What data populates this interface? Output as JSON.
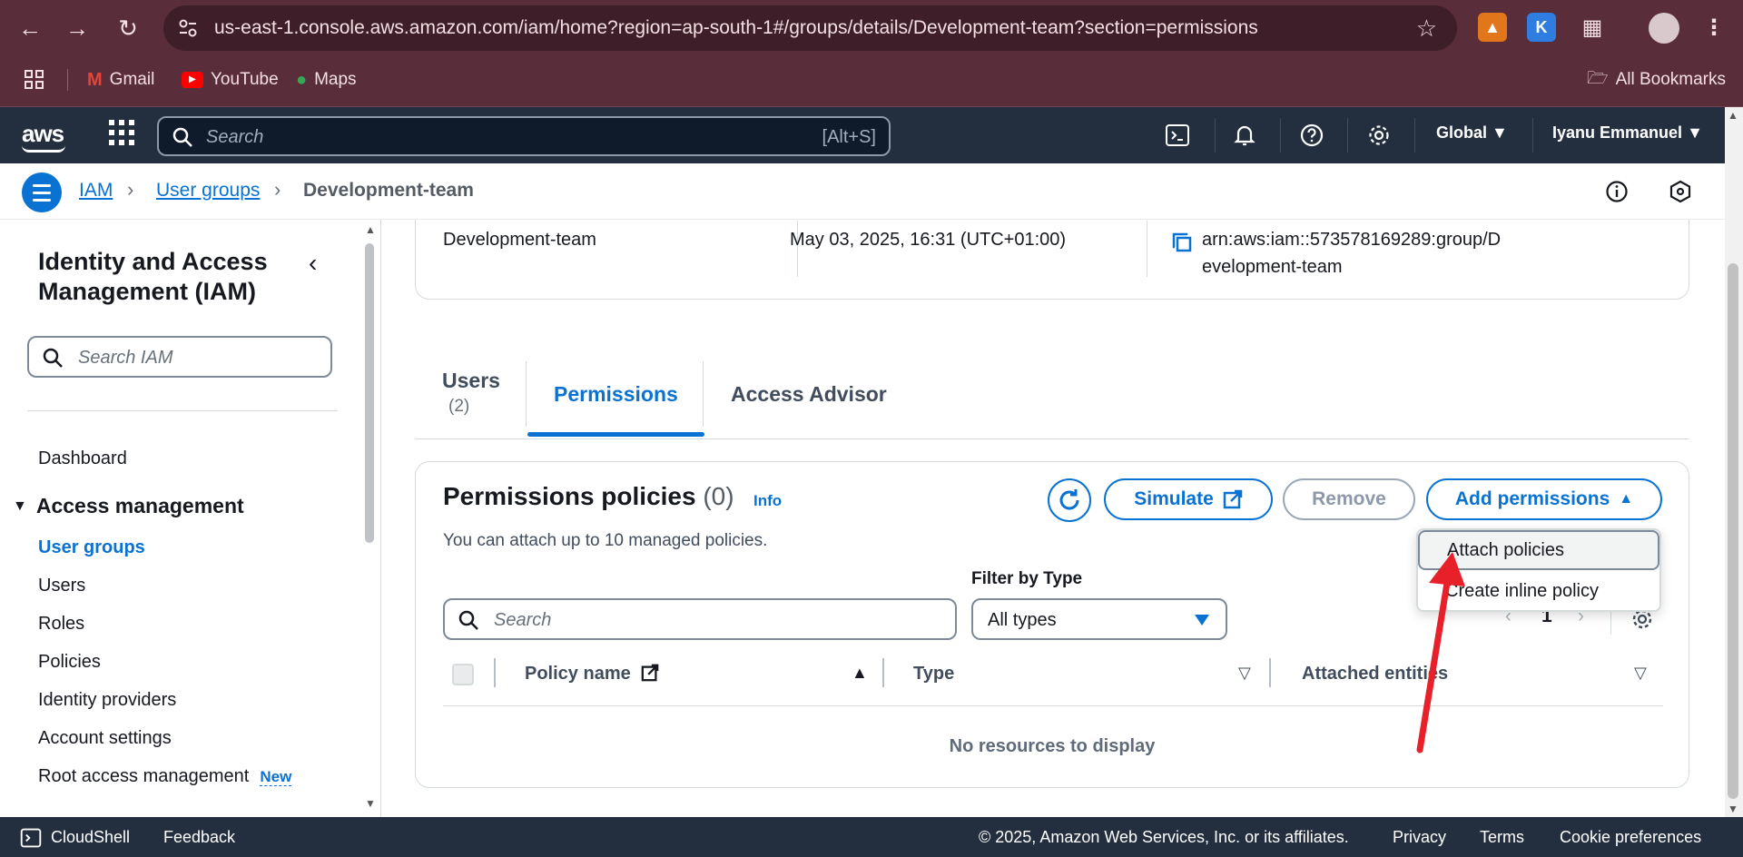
{
  "browser": {
    "url": "us-east-1.console.aws.amazon.com/iam/home?region=ap-south-1#/groups/details/Development-team?section=permissions",
    "bookmarks": [
      "Gmail",
      "YouTube",
      "Maps"
    ],
    "all_bookmarks": "All Bookmarks",
    "ext_k": "K"
  },
  "aws_nav": {
    "logo": "aws",
    "search_placeholder": "Search",
    "search_shortcut": "[Alt+S]",
    "region": "Global",
    "user": "Iyanu Emmanuel"
  },
  "breadcrumb": {
    "items": [
      "IAM",
      "User groups",
      "Development-team"
    ]
  },
  "sidebar": {
    "title": "Identity and Access Management (IAM)",
    "search_placeholder": "Search IAM",
    "dashboard": "Dashboard",
    "section": "Access management",
    "items": [
      "User groups",
      "Users",
      "Roles",
      "Policies",
      "Identity providers",
      "Account settings",
      "Root access management"
    ],
    "new_badge": "New"
  },
  "summary": {
    "group_name": "Development-team",
    "created": "May 03, 2025, 16:31 (UTC+01:00)",
    "arn_line1": "arn:aws:iam::573578169289:group/D",
    "arn_line2": "evelopment-team"
  },
  "tabs": {
    "users": "Users",
    "users_count": "(2)",
    "permissions": "Permissions",
    "access_advisor": "Access Advisor"
  },
  "permissions": {
    "title": "Permissions policies",
    "count": "(0)",
    "info": "Info",
    "description": "You can attach up to 10 managed policies.",
    "simulate": "Simulate",
    "remove": "Remove",
    "add_permissions": "Add permissions",
    "filter_label": "Filter by Type",
    "search_placeholder": "Search",
    "filter_value": "All types",
    "page": "1",
    "columns": [
      "Policy name",
      "Type",
      "Attached entities"
    ],
    "empty": "No resources to display"
  },
  "dropdown": {
    "items": [
      "Attach policies",
      "Create inline policy"
    ]
  },
  "footer": {
    "cloudshell": "CloudShell",
    "feedback": "Feedback",
    "copyright": "© 2025, Amazon Web Services, Inc. or its affiliates.",
    "privacy": "Privacy",
    "terms": "Terms",
    "cookies": "Cookie preferences"
  },
  "colors": {
    "accent": "#0972d3",
    "chrome": "#5a2d3a",
    "aws_nav": "#232f3e",
    "annotation_arrow": "#e8202a"
  }
}
